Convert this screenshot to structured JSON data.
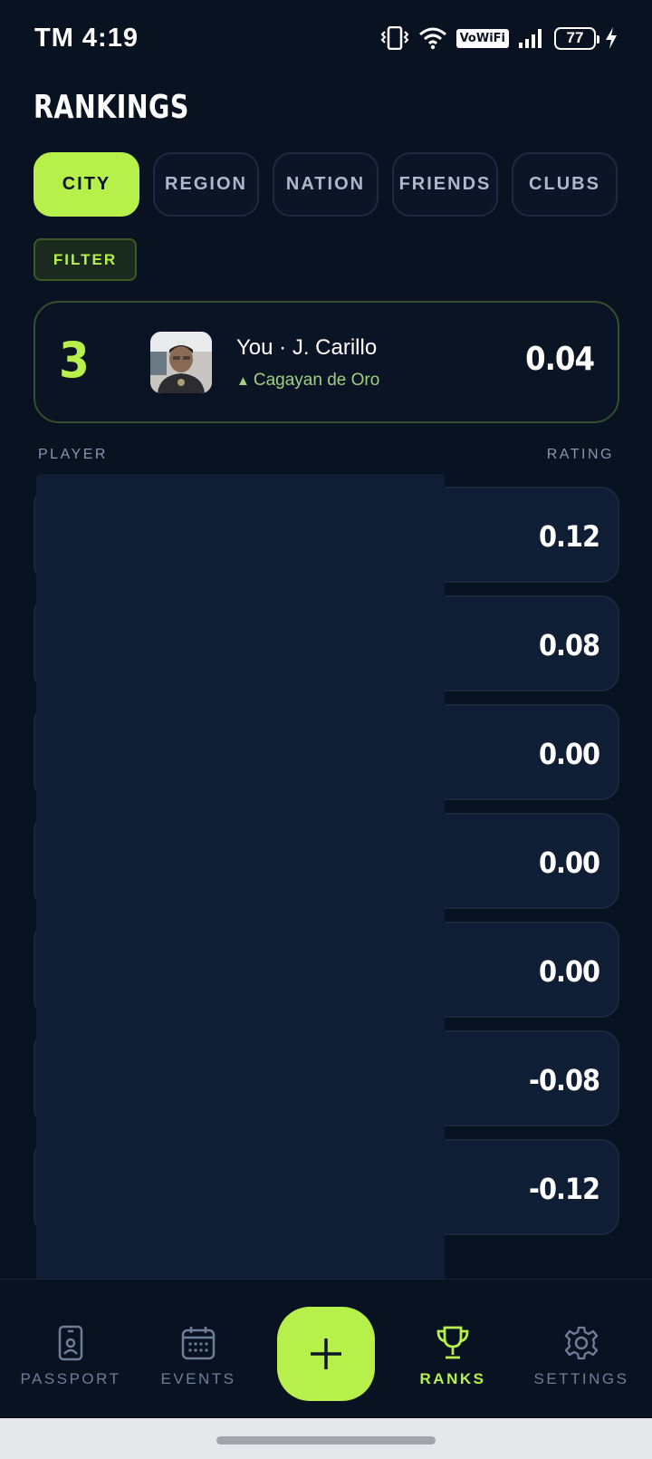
{
  "status_bar": {
    "time": "TM 4:19",
    "vowifi": "VoWiFi",
    "battery": "77"
  },
  "title": "RANKINGS",
  "tabs": [
    {
      "label": "CITY",
      "active": true
    },
    {
      "label": "REGION",
      "active": false
    },
    {
      "label": "NATION",
      "active": false
    },
    {
      "label": "FRIENDS",
      "active": false
    },
    {
      "label": "CLUBS",
      "active": false
    }
  ],
  "filter_label": "FILTER",
  "my_card": {
    "rank": "3",
    "name": "You · J. Carillo",
    "city_arrow": "▲",
    "city": "Cagayan de Oro",
    "rating": "0.04"
  },
  "columns": {
    "player": "PLAYER",
    "rating": "RATING"
  },
  "rows": [
    {
      "rating": "0.12"
    },
    {
      "rating": "0.08"
    },
    {
      "rating": "0.00"
    },
    {
      "rating": "0.00"
    },
    {
      "rating": "0.00"
    },
    {
      "rating": "-0.08"
    },
    {
      "rating": "-0.12"
    }
  ],
  "nav": {
    "passport": "PASSPORT",
    "events": "EVENTS",
    "ranks": "RANKS",
    "settings": "SETTINGS"
  },
  "colors": {
    "accent": "#b7f04a",
    "background": "#081221",
    "row_bg": "#0f1d35"
  }
}
